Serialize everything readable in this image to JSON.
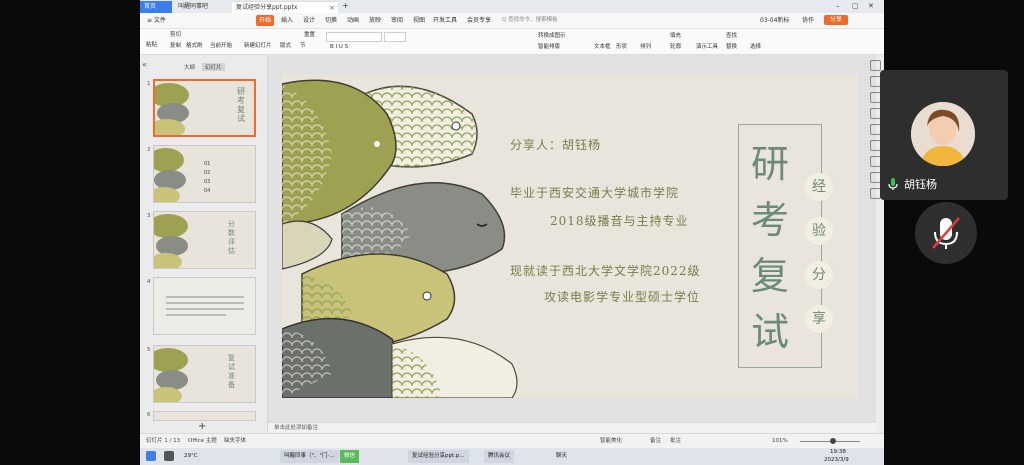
{
  "tabs": {
    "home": "首页",
    "tab1": "叫醒同事吧",
    "tab2": "复试经验分享ppt.pptx",
    "close": "×",
    "add": "+"
  },
  "window": {
    "minimize": "–",
    "maximize": "▢",
    "close": "✕"
  },
  "menu": {
    "file": "≡ 文件",
    "items": [
      "开始",
      "插入",
      "设计",
      "切换",
      "动画",
      "放映",
      "审阅",
      "视图",
      "开发工具",
      "会员专享"
    ],
    "active_index": 0,
    "search": "Q 查找命令、搜索模板",
    "sync": "03-04新标",
    "collab": "协作",
    "share": "分享"
  },
  "toolbar": {
    "paste": "粘贴",
    "cut": "剪切",
    "copy": "复制",
    "format_painter": "格式刷",
    "from_current": "当前开始",
    "new_slide": "新建幻灯片",
    "layout": "版式",
    "section": "节",
    "reset": "重置",
    "font_controls": "B I U S",
    "text_box": "文本框",
    "shape": "形状",
    "arrange": "排列",
    "outline": "轮廓",
    "find": "查找",
    "replace": "替换",
    "select": "选择",
    "present_tools": "演示工具",
    "convert_smartart": "转换成图示",
    "text_fill": "填充",
    "smart_layout": "智能排版"
  },
  "left_panel": {
    "outline_tab": "大纲",
    "slides_tab": "幻灯片",
    "collapse": "«",
    "add": "+",
    "thumbnails": [
      {
        "num": "1",
        "label": "研考复试",
        "selected": true
      },
      {
        "num": "2",
        "label": "01 02 03 04",
        "selected": false
      },
      {
        "num": "3",
        "label": "分数评估",
        "selected": false
      },
      {
        "num": "4",
        "label": "",
        "selected": false
      },
      {
        "num": "5",
        "label": "复试准备",
        "selected": false
      },
      {
        "num": "6",
        "label": "",
        "selected": false
      }
    ]
  },
  "slide": {
    "presenter": "分享人：胡钰杨",
    "line1": "毕业于西安交通大学城市学院",
    "line2": "2018级播音与主持专业",
    "line3": "现就读于西北大学文学院2022级",
    "line4": "攻读电影学专业型硕士学位",
    "title_chars": [
      "研",
      "考",
      "复",
      "试"
    ],
    "badges": [
      "经",
      "验",
      "分",
      "享"
    ],
    "colors": {
      "green": "#9ea052",
      "gray": "#8a8c86",
      "dark_gray": "#6c706a",
      "cream": "#f2eee2",
      "title": "#6c8b74",
      "text": "#7a7d48",
      "bg": "#e9e5dd"
    }
  },
  "notes": {
    "placeholder": "单击此处添加备注"
  },
  "status": {
    "slide_count": "幻灯片 1 / 13",
    "theme": "Office 主题",
    "font_missing": "缺失字体",
    "smart_beautify": "智能美化",
    "notes": "备注",
    "comment": "批注",
    "zoom": "101%"
  },
  "taskbar": {
    "weather": "29°C",
    "app1": "叫醒同事（\"、\"门·...",
    "app2": "微信",
    "app3": "复试经验分享ppt.p...",
    "app4": "腾讯会议",
    "app5": "聊天",
    "time": "19:38",
    "date": "2023/3/9"
  },
  "meeting": {
    "participant_name": "胡钰杨"
  }
}
